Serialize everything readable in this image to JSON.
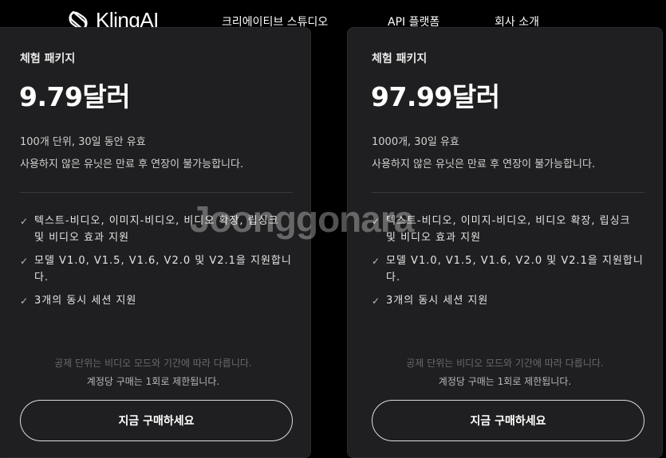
{
  "header": {
    "brand": "KlingAI",
    "nav": [
      {
        "label": "크리에이티브 스튜디오"
      },
      {
        "label": "API 플랫폼"
      },
      {
        "label": "회사 소개"
      }
    ]
  },
  "cards": [
    {
      "plan_name": "체험 패키지",
      "price": "9.79달러",
      "desc1": "100개 단위, 30일 동안 유효",
      "desc2": "사용하지 않은 유닛은 만료 후 연장이 불가능합니다.",
      "features": [
        "텍스트-비디오, 이미지-비디오, 비디오 확장, 립싱크 및 비디오 효과 지원",
        "모델 V1.0, V1.5, V1.6, V2.0 및 V2.1을 지원합니다.",
        "3개의 동시 세션 지원"
      ],
      "footnote1": "공제 단위는 비디오 모드와 기간에 따라 다릅니다.",
      "footnote2": "계정당 구매는 1회로 제한됩니다.",
      "button": "지금 구매하세요"
    },
    {
      "plan_name": "체험 패키지",
      "price": "97.99달러",
      "desc1": "1000개, 30일 유효",
      "desc2": "사용하지 않은 유닛은 만료 후 연장이 불가능합니다.",
      "features": [
        "텍스트-비디오, 이미지-비디오, 비디오 확장, 립싱크 및 비디오 효과 지원",
        "모델 V1.0, V1.5, V1.6, V2.0 및 V2.1을 지원합니다.",
        "3개의 동시 세션 지원"
      ],
      "footnote1": "공제 단위는 비디오 모드와 기간에 따라 다릅니다.",
      "footnote2": "계정당 구매는 1회로 제한됩니다.",
      "button": "지금 구매하세요"
    }
  ],
  "watermark": "Joonggonara",
  "colors": {
    "background": "#000000",
    "card": "#1f1f21",
    "text": "#ffffff",
    "muted": "#6a6a6d"
  },
  "icons": {
    "feature": "check-icon",
    "logo": "kling-logo-icon"
  }
}
